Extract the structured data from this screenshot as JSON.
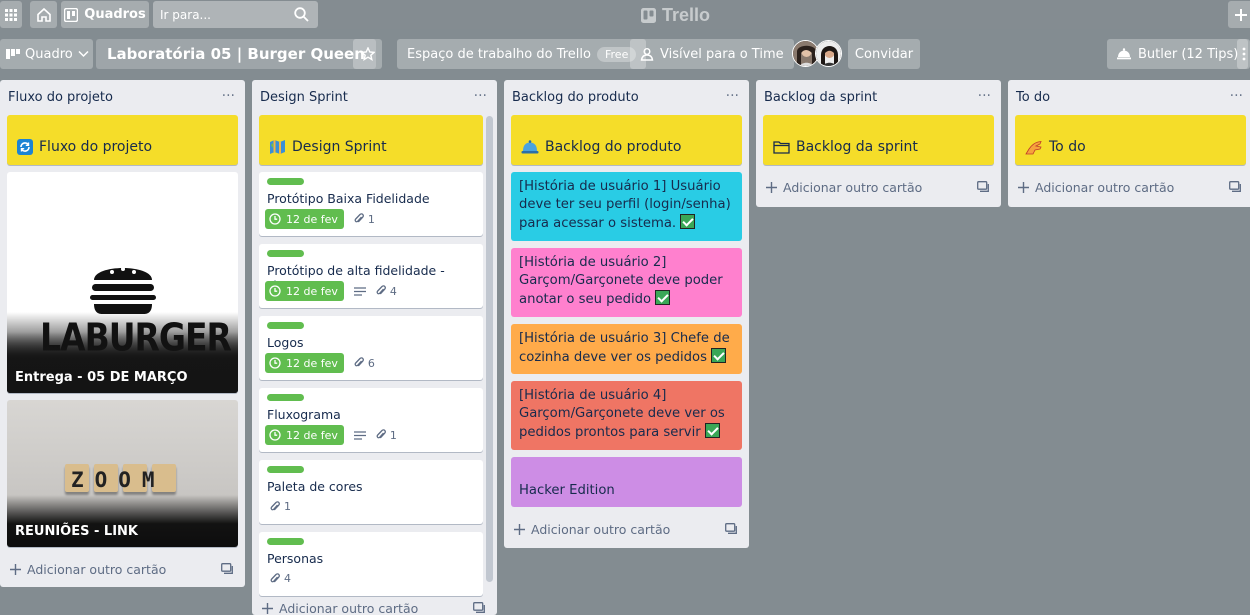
{
  "topnav": {
    "boards_label": "Quadros",
    "search_placeholder": "Ir para...",
    "logo_text": "Trello"
  },
  "board_header": {
    "view_label": "Quadro",
    "title": "Laboratória 05 | Burger Queen",
    "workspace_label": "Espaço de trabalho do Trello",
    "workspace_badge": "Free",
    "visibility_label": "Visível para o Time",
    "invite_label": "Convidar",
    "butler_label": "Butler (12 Tips)"
  },
  "lists": [
    {
      "title": "Fluxo do projeto",
      "header_card": "Fluxo do projeto",
      "cover_cards": [
        {
          "logo_text": "LABURGER",
          "label": "Entrega - 05 DE MARÇO"
        },
        {
          "logo_text": "ZOOM",
          "label": "REUNIÕES - LINK"
        }
      ],
      "add_label": "Adicionar outro cartão"
    },
    {
      "title": "Design Sprint",
      "header_card": "Design Sprint",
      "cards": [
        {
          "title": "Protótipo Baixa Fidelidade",
          "due": "12 de fev",
          "attachments": "1"
        },
        {
          "title": "Protótipo de alta fidelidade - Figma",
          "due": "12 de fev",
          "attachments": "4"
        },
        {
          "title": "Logos",
          "due": "12 de fev",
          "attachments": "6"
        },
        {
          "title": "Fluxograma",
          "due": "12 de fev",
          "attachments": "1"
        },
        {
          "title": "Paleta de cores",
          "attachments": "1"
        },
        {
          "title": "Personas",
          "attachments": "4"
        }
      ],
      "add_label": "Adicionar outro cartão"
    },
    {
      "title": "Backlog do produto",
      "header_card": "Backlog do produto",
      "stories": [
        {
          "text": "[História de usuário 1] Usuário deve ter seu perfil (login/senha) para acessar o sistema.",
          "color": "#29cce5"
        },
        {
          "text": "[História de usuário 2] Garçom/Garçonete deve poder anotar o seu pedido",
          "color": "#ff80ce"
        },
        {
          "text": "[História de usuário 3] Chefe de cozinha deve ver os pedidos",
          "color": "#ffab4a"
        },
        {
          "text": "[História de usuário 4] Garçom/Garçonete deve ver os pedidos prontos para servir",
          "color": "#ef7564"
        },
        {
          "text": "Hacker Edition",
          "color": "#cd8de5"
        }
      ],
      "add_label": "Adicionar outro cartão"
    },
    {
      "title": "Backlog da sprint",
      "header_card": "Backlog da sprint",
      "add_label": "Adicionar outro cartão"
    },
    {
      "title": "To do",
      "header_card": "To do",
      "add_label": "Adicionar outro cartão"
    }
  ],
  "colors": {
    "board_bg": "#838c91",
    "header_card": "#f5dd29",
    "due_green": "#61bd4f"
  }
}
